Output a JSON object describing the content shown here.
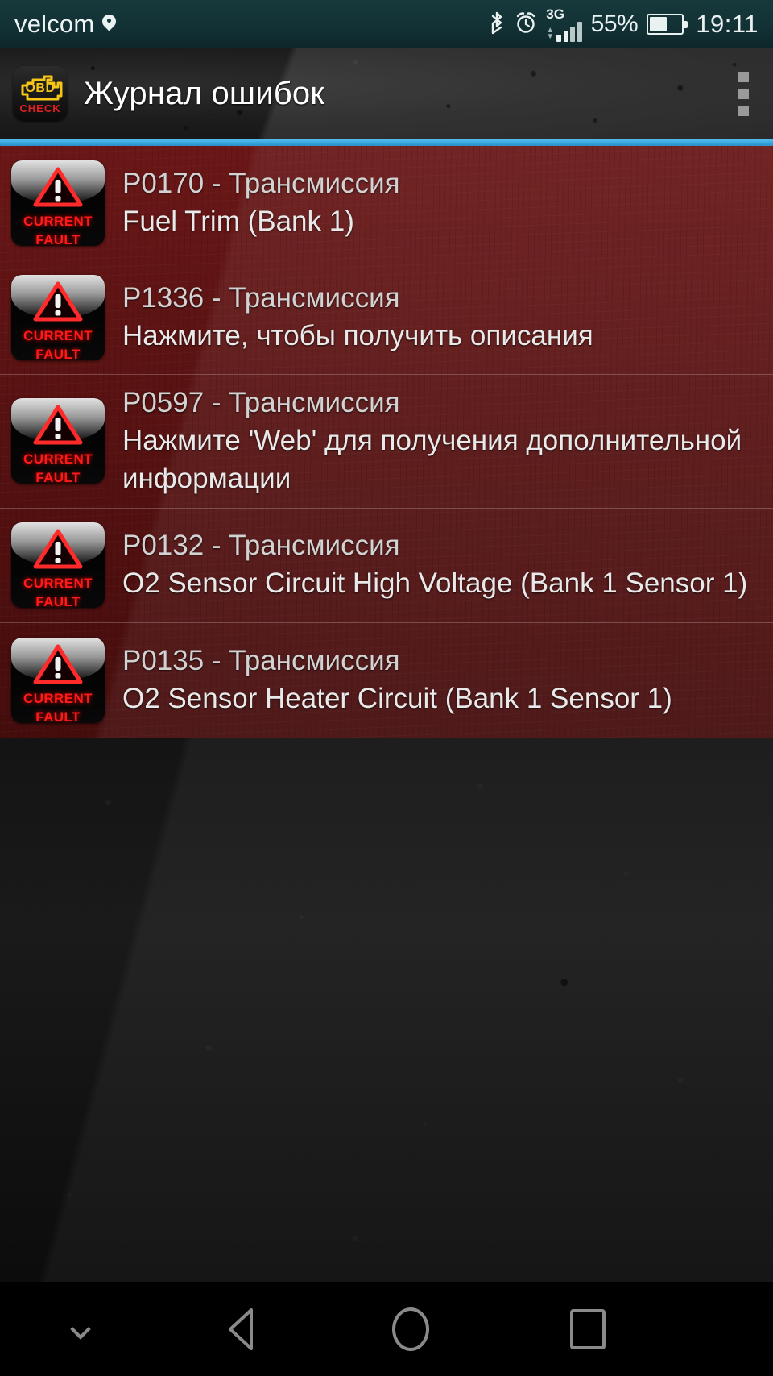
{
  "status_bar": {
    "carrier": "velcom",
    "location_icon": "location-pin-icon",
    "bluetooth_icon": "bluetooth-icon",
    "alarm_icon": "alarm-clock-icon",
    "network_type": "3G",
    "signal_icon": "signal-bars-icon",
    "battery_percent": "55%",
    "battery_level": 55,
    "battery_icon": "battery-icon",
    "clock": "19:11"
  },
  "action_bar": {
    "app_icon": {
      "name": "obd-check-app-icon",
      "primary_text": "OBD",
      "secondary_text": "CHECK",
      "primary_color": "#f5c518",
      "secondary_color": "#e02020"
    },
    "title": "Журнал ошибок",
    "overflow_menu_icon": "overflow-menu-icon"
  },
  "theme": {
    "accent_line": "#3aa9e0",
    "status_bar_bg": "#123134",
    "list_bg": "#5c1313",
    "fault_red": "#ff1a1a"
  },
  "fault_list": {
    "badge": {
      "line1": "CURRENT",
      "line2": "FAULT",
      "icon": "warning-triangle-icon"
    },
    "items": [
      {
        "code": "P0170 - Трансмиссия",
        "description": "Fuel Trim (Bank 1)"
      },
      {
        "code": "P1336 - Трансмиссия",
        "description": "Нажмите, чтобы получить описания"
      },
      {
        "code": "P0597 - Трансмиссия",
        "description": "Нажмите 'Web' для получения дополнительной информации"
      },
      {
        "code": "P0132 - Трансмиссия",
        "description": "O2 Sensor Circuit High Voltage (Bank 1 Sensor 1)"
      },
      {
        "code": "P0135 - Трансмиссия",
        "description": "O2 Sensor Heater Circuit (Bank 1 Sensor 1)"
      }
    ]
  },
  "nav_bar": {
    "hide_icon": "chevron-down-icon",
    "back_icon": "back-triangle-icon",
    "home_icon": "home-circle-icon",
    "recents_icon": "recents-square-icon"
  }
}
